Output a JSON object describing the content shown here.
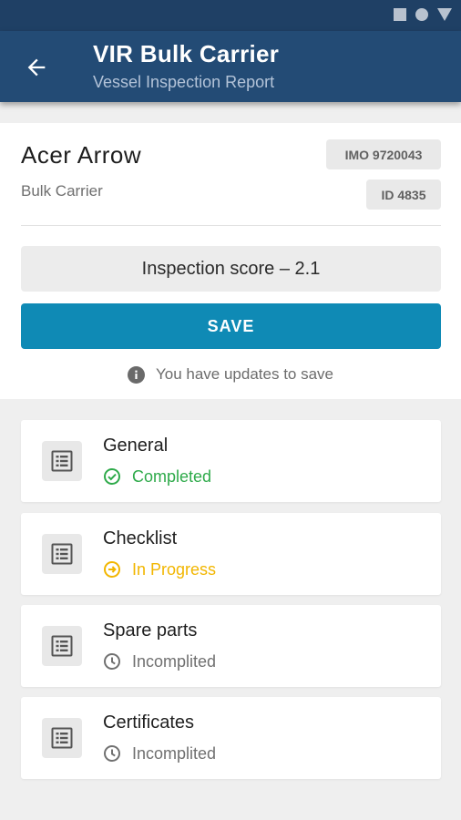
{
  "app": {
    "title": "VIR Bulk Carrier",
    "subtitle": "Vessel Inspection Report"
  },
  "vessel": {
    "name": "Acer Arrow",
    "type": "Bulk Carrier",
    "imo": "IMO 9720043",
    "id": "ID 4835"
  },
  "inspection": {
    "score_text": "Inspection score – 2.1"
  },
  "actions": {
    "save_label": "SAVE",
    "notice": "You have updates to save"
  },
  "sections": [
    {
      "title": "General",
      "status": "Completed",
      "status_icon": "check-circle-icon",
      "status_color": "#2eaa4a"
    },
    {
      "title": "Checklist",
      "status": "In Progress",
      "status_icon": "arrow-circle-icon",
      "status_color": "#f2b600"
    },
    {
      "title": "Spare parts",
      "status": "Incomplited",
      "status_icon": "clock-icon",
      "status_color": "#707070"
    },
    {
      "title": "Certificates",
      "status": "Incomplited",
      "status_icon": "clock-icon",
      "status_color": "#707070"
    }
  ],
  "colors": {
    "statusbar": "#1f4065",
    "appbar": "#234b75",
    "accent": "#0f8ab5",
    "background": "#efefef"
  }
}
